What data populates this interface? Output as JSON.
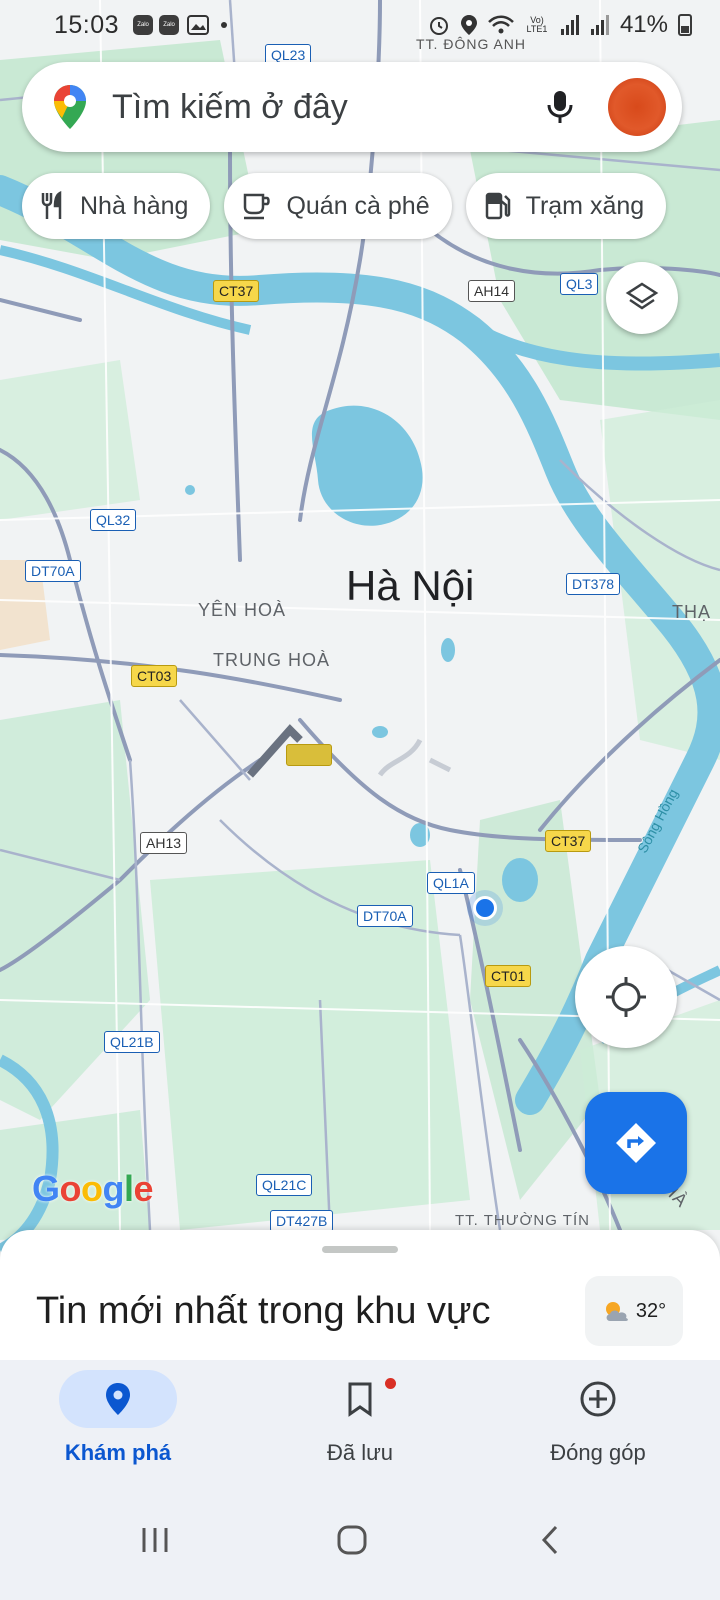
{
  "status_bar": {
    "time": "15:03",
    "notif_icons": [
      "Zalo",
      "Zalo"
    ],
    "network": "Vo) LTE1",
    "battery": "41%"
  },
  "search": {
    "placeholder": "Tìm kiếm ở đây"
  },
  "chips": [
    {
      "label": "Nhà hàng",
      "icon": "fork-knife-icon"
    },
    {
      "label": "Quán cà phê",
      "icon": "coffee-cup-icon"
    },
    {
      "label": "Trạm xăng",
      "icon": "gas-station-icon"
    }
  ],
  "map": {
    "city": "Hà Nội",
    "place_labels": {
      "dong_anh": "TT. ĐÔNG ANH",
      "yen_hoa": "YÊN HOÀ",
      "trung_hoa": "TRUNG HOÀ",
      "thuong_tin": "TT. THƯỜNG TÍN",
      "tha": "THẠ",
      "ha": "HÀ"
    },
    "river": "Sông Hồng",
    "road_shields": {
      "ql23": "QL23",
      "ct37_top": "CT37",
      "ah14": "AH14",
      "ql3": "QL3",
      "ql32": "QL32",
      "dt70a_left": "DT70A",
      "dt378": "DT378",
      "ct03": "CT03",
      "ah13": "AH13",
      "ct37_right": "CT37",
      "ql1a": "QL1A",
      "dt70a_mid": "DT70A",
      "ct01": "CT01",
      "ql21b": "QL21B",
      "ql21c": "QL21C",
      "dt427b": "DT427B"
    },
    "attribution": "Google"
  },
  "sheet": {
    "title": "Tin mới nhất trong khu vực",
    "temperature": "32°"
  },
  "bottom_nav": [
    {
      "label": "Khám phá",
      "active": true
    },
    {
      "label": "Đã lưu",
      "active": false
    },
    {
      "label": "Đóng góp",
      "active": false
    }
  ],
  "colors": {
    "accent": "#1a73e8",
    "water": "#7cc6e0",
    "park": "#bfe6cc",
    "road_major": "#8f9bb8",
    "shield_yellow": "#f6d74a"
  }
}
